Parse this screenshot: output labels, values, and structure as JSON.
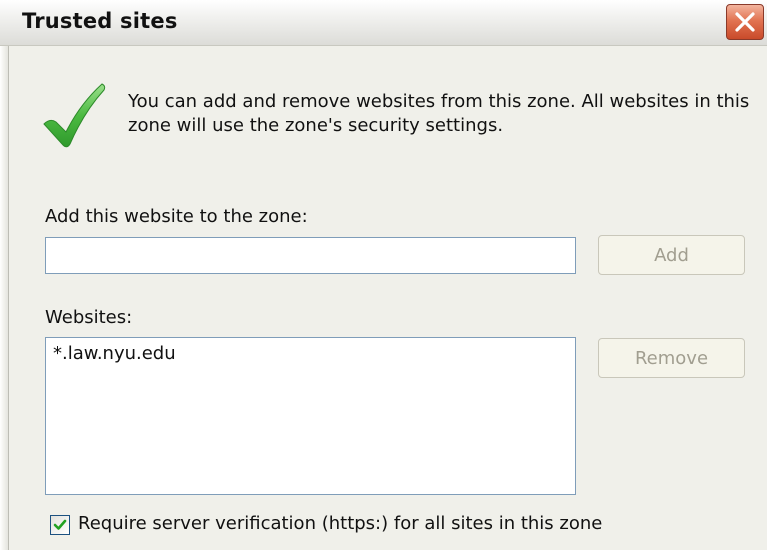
{
  "window": {
    "title": "Trusted sites",
    "close_icon": "close-x-icon"
  },
  "info": {
    "icon": "green-checkmark-icon",
    "text": "You can add and remove websites from this zone. All websites in this zone will use the zone's security settings."
  },
  "add_site": {
    "label": "Add this website to the zone:",
    "value": "",
    "button_label": "Add"
  },
  "websites": {
    "label": "Websites:",
    "items": [
      "*.law.nyu.edu"
    ],
    "remove_label": "Remove"
  },
  "verification": {
    "label": "Require server verification (https:) for all sites in this zone",
    "checked": true
  },
  "colors": {
    "check_green": "#44b83e",
    "close_red": "#e27452",
    "dialog_bg": "#f0f0ea",
    "disabled_text": "#a19e90",
    "input_border": "#7f9db9"
  }
}
